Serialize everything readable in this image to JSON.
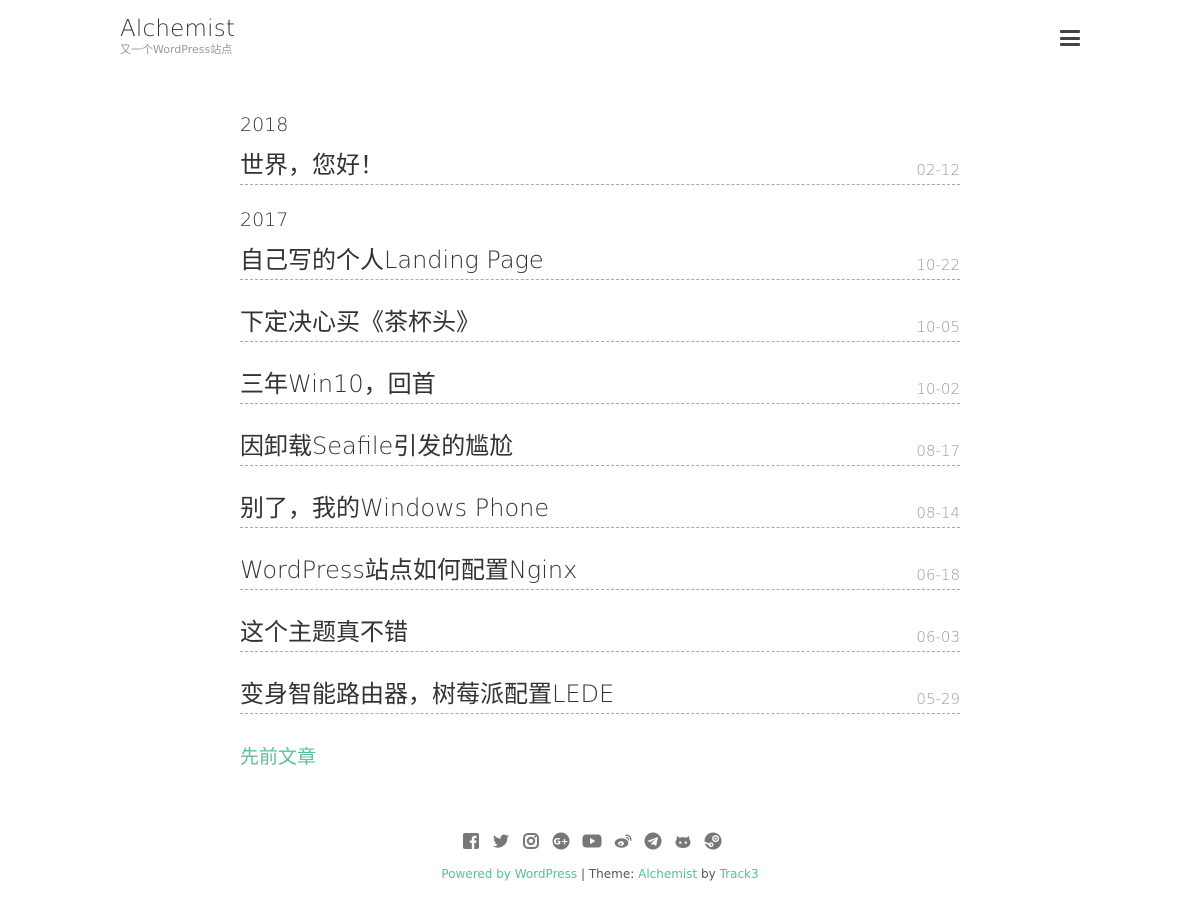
{
  "site": {
    "title": "Alchemist",
    "description": "又一个WordPress站点"
  },
  "archive": [
    {
      "year": "2018",
      "posts": [
        {
          "title": "世界，您好！",
          "date": "02-12"
        }
      ]
    },
    {
      "year": "2017",
      "posts": [
        {
          "title": "自己写的个人Landing Page",
          "date": "10-22"
        },
        {
          "title": "下定决心买《茶杯头》",
          "date": "10-05"
        },
        {
          "title": "三年Win10，回首",
          "date": "10-02"
        },
        {
          "title": "因卸载Seafile引发的尴尬",
          "date": "08-17"
        },
        {
          "title": "别了，我的Windows Phone",
          "date": "08-14"
        },
        {
          "title": "WordPress站点如何配置Nginx",
          "date": "06-18"
        },
        {
          "title": "这个主题真不错",
          "date": "06-03"
        },
        {
          "title": "变身智能路由器，树莓派配置LEDE",
          "date": "05-29"
        }
      ]
    }
  ],
  "pagination": {
    "older_label": "先前文章"
  },
  "social_icons": [
    "facebook-icon",
    "twitter-icon",
    "instagram-icon",
    "google-plus-icon",
    "youtube-icon",
    "weibo-icon",
    "telegram-icon",
    "github-icon",
    "steam-icon"
  ],
  "footer": {
    "powered_link": "Powered by WordPress",
    "separator": "|",
    "theme_prefix": "Theme:",
    "theme_link": "Alchemist",
    "by_text": "by",
    "author_link": "Track3"
  },
  "colors": {
    "accent": "#5bbf9a",
    "text": "#333333",
    "muted": "#999999",
    "icon": "#777777"
  }
}
